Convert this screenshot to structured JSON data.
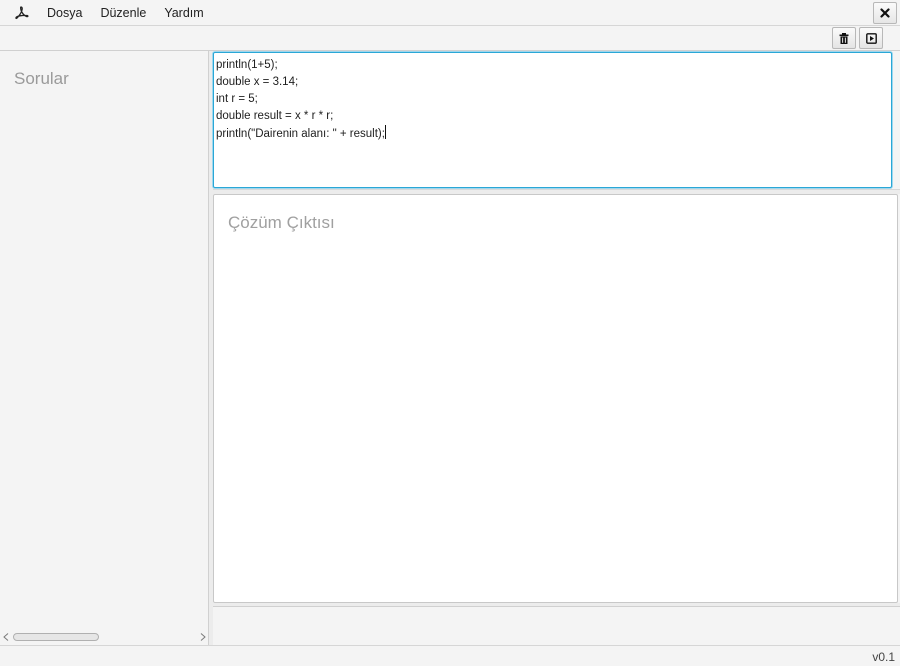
{
  "menu": {
    "app_icon": "acrobat-like-icon",
    "items": [
      {
        "label": "Dosya"
      },
      {
        "label": "Düzenle"
      },
      {
        "label": "Yardım"
      }
    ],
    "close_icon": "close-x-icon"
  },
  "toolbar": {
    "trash_icon": "trash-icon",
    "run_icon": "play-box-icon"
  },
  "left_panel": {
    "title": "Sorular"
  },
  "editor": {
    "lines": [
      "println(1+5);",
      "double x = 3.14;",
      "int r = 5;",
      "double result = x * r * r;",
      "println(\"Dairenin alanı: \" + result);"
    ],
    "accent_color": "#2aa7d6"
  },
  "output": {
    "title": "Çözüm Çıktısı"
  },
  "status": {
    "version": "v0.1"
  }
}
